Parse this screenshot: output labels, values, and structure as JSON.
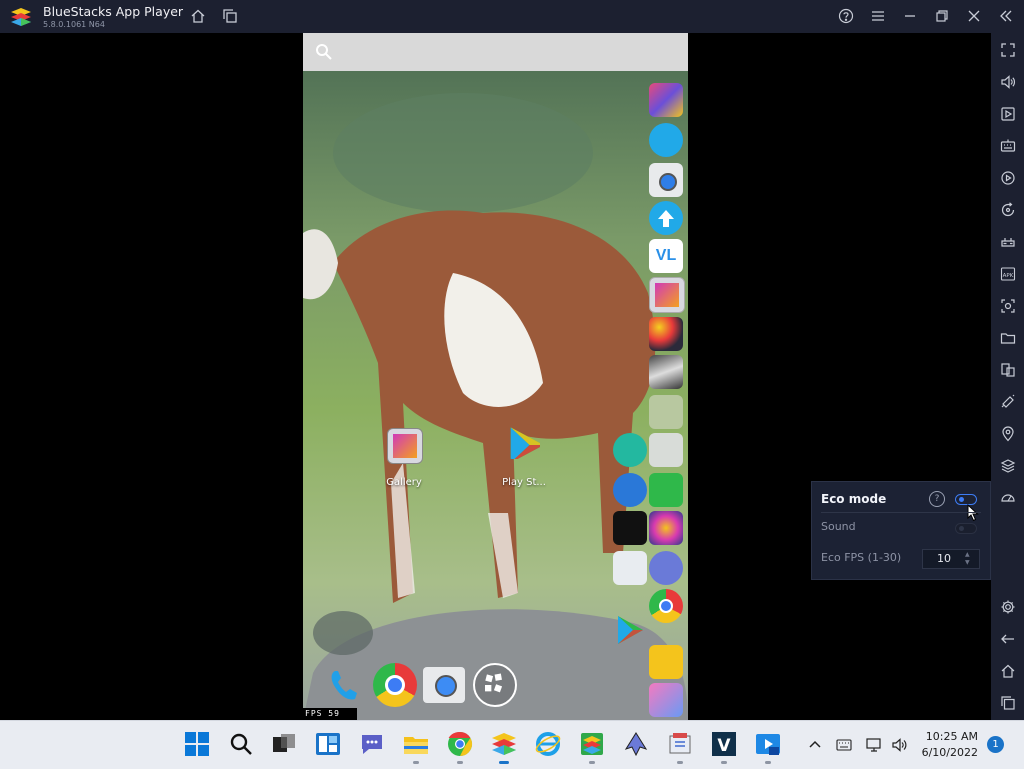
{
  "window": {
    "title": "BlueStacks App Player",
    "version": "5.8.0.1061 N64"
  },
  "titlebar_buttons": [
    "home-icon",
    "multi-instance-icon",
    "help-icon",
    "menu-icon",
    "minimize-icon",
    "restore-icon",
    "close-icon",
    "collapse-sidebar-icon"
  ],
  "sidebar": {
    "items": [
      "fullscreen-icon",
      "volume-icon",
      "media-manager-icon",
      "keyboard-icon",
      "macro-icon",
      "rotate-icon",
      "gamepad-icon",
      "install-apk-icon",
      "screenshot-icon",
      "folder-icon",
      "multi-instance-manager-icon",
      "shake-icon",
      "location-icon",
      "layers-icon",
      "eco-mode-icon",
      "settings-icon",
      "back-icon",
      "home-icon",
      "recent-apps-icon"
    ]
  },
  "android": {
    "search_icon": "search-icon",
    "desktop_icons": [
      {
        "name": "gallery",
        "label": "Gallery"
      },
      {
        "name": "play-store",
        "label": "Play St..."
      }
    ],
    "dock": [
      "phone-icon",
      "chrome-icon",
      "camera-icon",
      "app-drawer-icon"
    ],
    "fps_label": "FPS  59"
  },
  "eco_panel": {
    "title": "Eco mode",
    "help": "?",
    "eco_enabled": true,
    "sound_label": "Sound",
    "sound_enabled": false,
    "fps_label": "Eco FPS (1-30)",
    "fps_value": "10"
  },
  "taskbar": {
    "apps": [
      "start-icon",
      "search-icon",
      "task-view-icon",
      "widgets-icon",
      "teams-chat-icon",
      "file-explorer-icon",
      "chrome-icon",
      "bluestacks-icon",
      "internet-explorer-icon",
      "bluestacks-multi-instance-icon",
      "inkscape-icon",
      "package-icon",
      "virtualbox-icon",
      "media-player-icon"
    ],
    "clock_time": "10:25 AM",
    "clock_date": "6/10/2022",
    "notification_count": "1"
  },
  "colors": {
    "chrome_bg": "#1c2030",
    "accent": "#3d7cf4",
    "taskbar_bg": "#e9ecf2"
  }
}
